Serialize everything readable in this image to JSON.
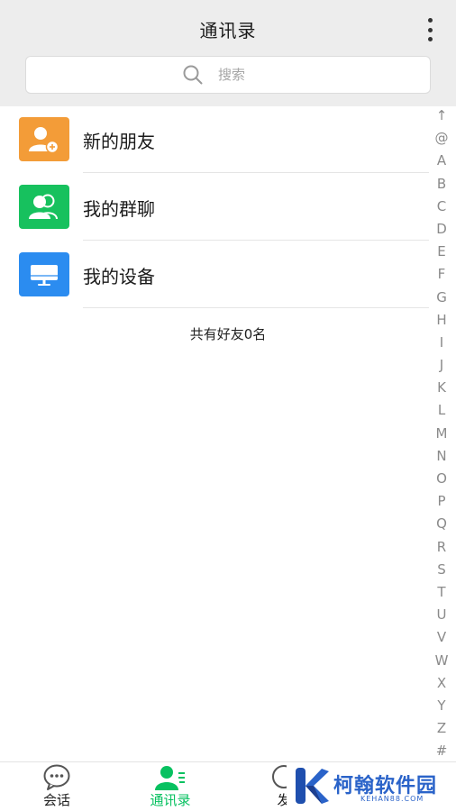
{
  "header": {
    "title": "通讯录",
    "more_icon": "more-vertical-icon"
  },
  "search": {
    "placeholder": "搜索",
    "icon": "search-icon"
  },
  "entries": [
    {
      "label": "新的朋友",
      "icon": "add-friend-icon",
      "color": "#f39c38"
    },
    {
      "label": "我的群聊",
      "icon": "group-chat-icon",
      "color": "#17c15e"
    },
    {
      "label": "我的设备",
      "icon": "device-icon",
      "color": "#2b8cf0"
    }
  ],
  "friend_count": "共有好友0名",
  "index_letters": [
    "↑",
    "@",
    "A",
    "B",
    "C",
    "D",
    "E",
    "F",
    "G",
    "H",
    "I",
    "J",
    "K",
    "L",
    "M",
    "N",
    "O",
    "P",
    "Q",
    "R",
    "S",
    "T",
    "U",
    "V",
    "W",
    "X",
    "Y",
    "Z",
    "#"
  ],
  "tabs": [
    {
      "label": "会话",
      "icon": "chat-bubble-icon",
      "active": false
    },
    {
      "label": "通讯录",
      "icon": "contacts-icon",
      "active": true
    },
    {
      "label": "发",
      "icon": "discover-icon",
      "active": false
    }
  ],
  "watermark": {
    "name": "柯翰软件园",
    "url": "KEHAN88.COM"
  },
  "colors": {
    "accent": "#07c160",
    "header_bg": "#ededed"
  }
}
